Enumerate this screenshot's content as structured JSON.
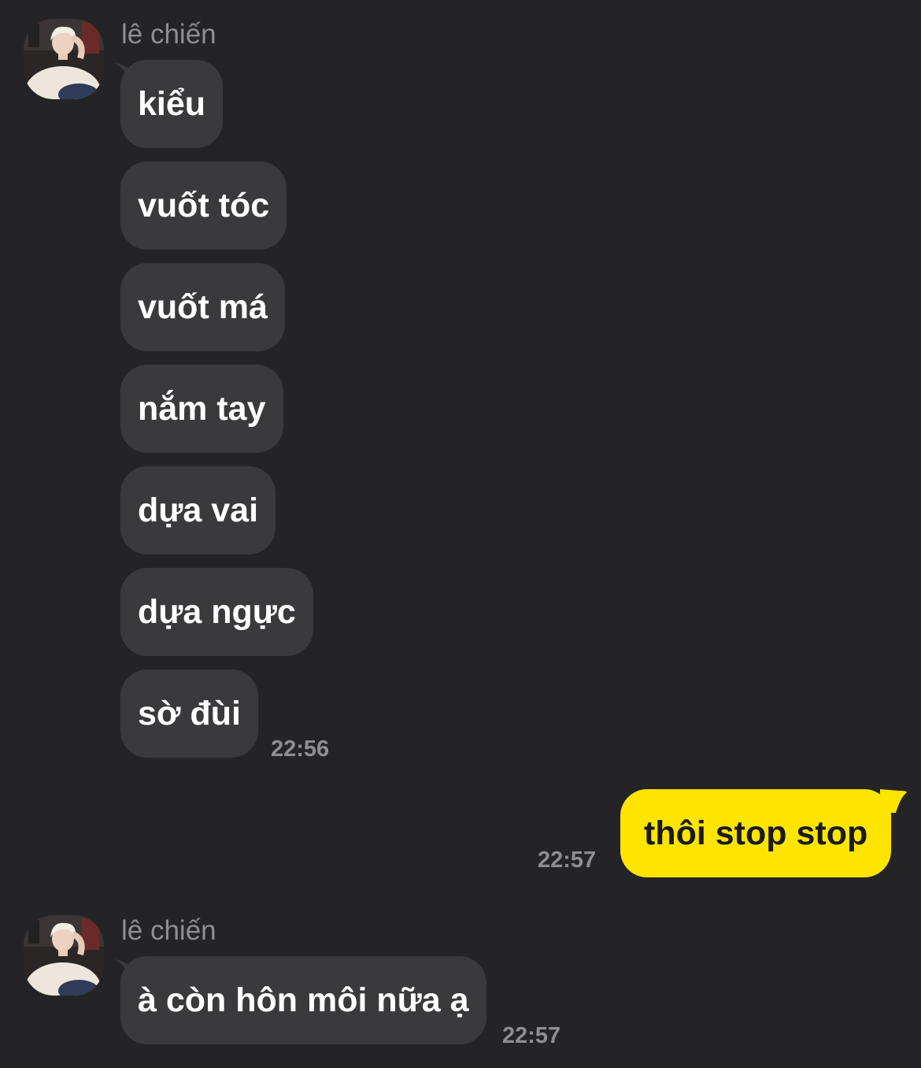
{
  "colors": {
    "background": "#242426",
    "incoming_bubble": "#3a3a3c",
    "outgoing_bubble": "#fee500",
    "incoming_text": "#ffffff",
    "outgoing_text": "#1a1a1a",
    "meta_text": "#8e8e93"
  },
  "group1": {
    "sender": "lê chiến",
    "avatar_icon": "profile-photo-avatar",
    "messages": [
      "kiểu",
      "vuốt tóc",
      "vuốt má",
      "nắm tay",
      "dựa vai",
      "dựa ngực",
      "sờ đùi"
    ],
    "time": "22:56"
  },
  "outgoing": {
    "message": "thôi stop stop",
    "time": "22:57"
  },
  "group2": {
    "sender": "lê chiến",
    "avatar_icon": "profile-photo-avatar",
    "messages": [
      "à còn hôn môi nữa ạ"
    ],
    "time": "22:57"
  }
}
